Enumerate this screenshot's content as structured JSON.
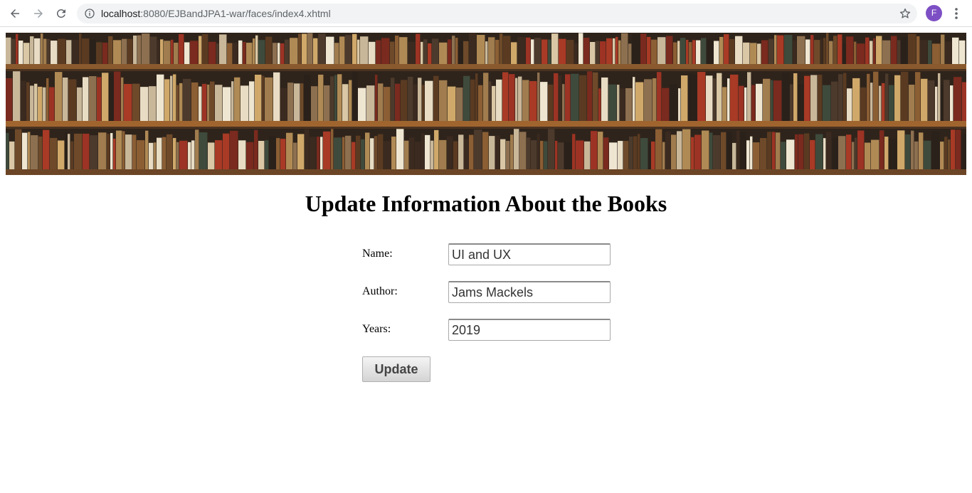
{
  "browser": {
    "url_host": "localhost",
    "url_path": ":8080/EJBandJPA1-war/faces/index4.xhtml",
    "profile_initial": "F"
  },
  "page": {
    "title": "Update Information About the Books"
  },
  "form": {
    "name_label": "Name:",
    "name_value": "UI and UX",
    "author_label": "Author:",
    "author_value": "Jams Mackels",
    "years_label": "Years:",
    "years_value": "2019",
    "submit_label": "Update"
  },
  "colors": {
    "avatar": "#7d4fc4",
    "button_gradient_top": "#f4f4f4",
    "button_gradient_bottom": "#d4d4d4"
  }
}
